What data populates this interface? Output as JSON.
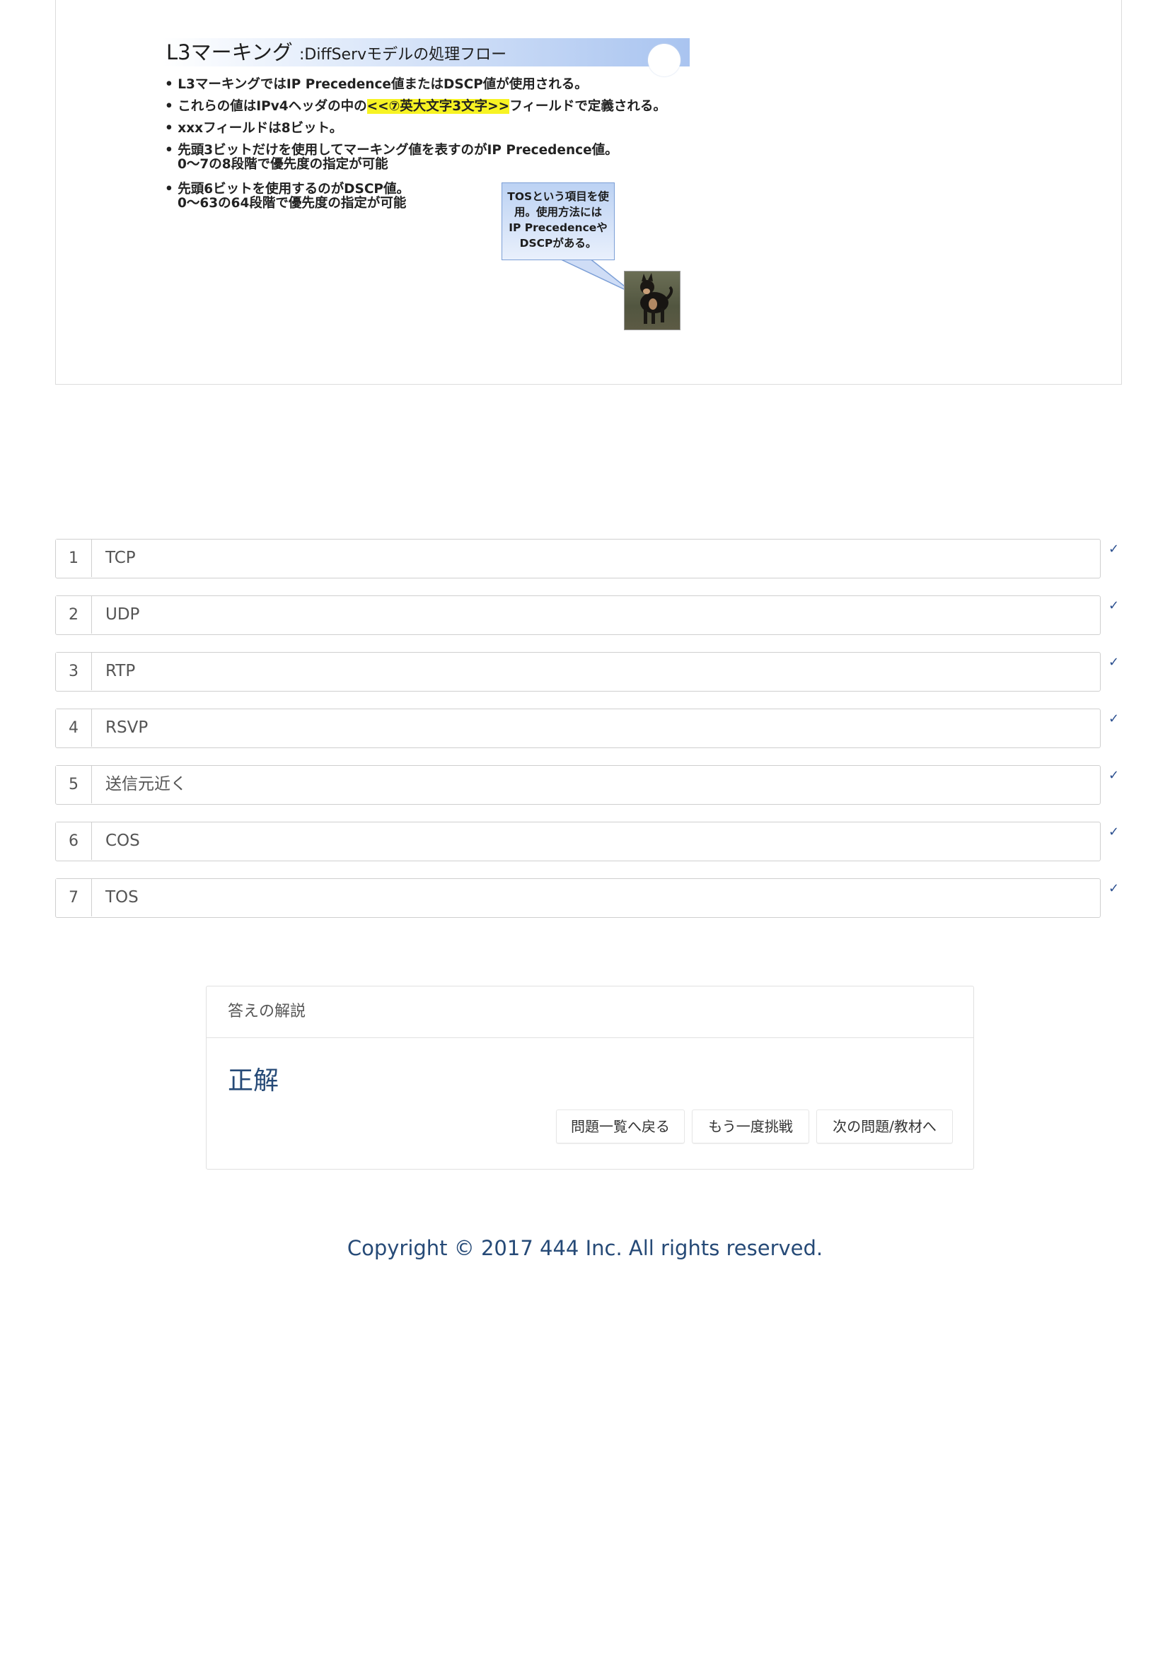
{
  "slide": {
    "title_main": "L3マーキング",
    "title_sub": ":DiffServモデルの処理フロー",
    "bullets": [
      "• L3マーキングではIP Precedence値またはDSCP値が使用される。",
      "• これらの値はIPv4ヘッダの中の",
      "• xxxフィールドは8ビット。",
      "• 先頭3ビットだけを使用してマーキング値を表すのがIP Precedence値。",
      "• 先頭6ビットを使用するのがDSCP値。"
    ],
    "bullet2_highlight": "<<⑦英大文字3文字>>",
    "bullet2_tail": "フィールドで定義される。",
    "bullet4_cont": "0～7の8段階で優先度の指定が可能",
    "bullet5_cont": "0～63の64段階で優先度の指定が可能",
    "bubble_lines": [
      "TOSという項目を使",
      "用。使用方法には",
      "IP Precedenceや",
      "DSCPがある。"
    ]
  },
  "answers": [
    {
      "num": "1",
      "text": "TCP",
      "check": "✓"
    },
    {
      "num": "2",
      "text": "UDP",
      "check": "✓"
    },
    {
      "num": "3",
      "text": "RTP",
      "check": "✓"
    },
    {
      "num": "4",
      "text": "RSVP",
      "check": "✓"
    },
    {
      "num": "5",
      "text": "送信元近く",
      "check": "✓"
    },
    {
      "num": "6",
      "text": "COS",
      "check": "✓"
    },
    {
      "num": "7",
      "text": "TOS",
      "check": "✓"
    }
  ],
  "explanation": {
    "header": "答えの解説",
    "result": "正解",
    "buttons": {
      "back_to_list": "問題一覧へ戻る",
      "retry": "もう一度挑戦",
      "next": "次の問題/教材へ"
    }
  },
  "footer": {
    "copyright": "Copyright © 2017 444 Inc. All rights reserved."
  }
}
